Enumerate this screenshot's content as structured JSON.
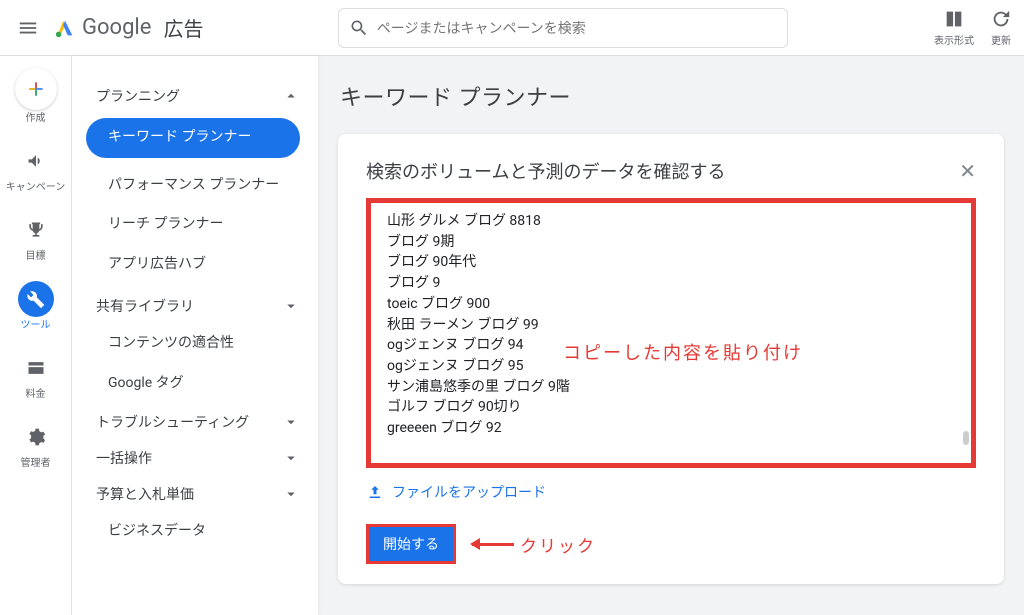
{
  "header": {
    "logo_brand": "Google",
    "logo_product": "広告",
    "search_placeholder": "ページまたはキャンペーンを検索",
    "actions": {
      "layout": "表示形式",
      "refresh": "更新"
    }
  },
  "rail": {
    "create": "作成",
    "campaign": "キャンペーン",
    "goal": "目標",
    "tools": "ツール",
    "billing": "料金",
    "admin": "管理者"
  },
  "side": {
    "planning": "プランニング",
    "keyword_planner": "キーワード プランナー",
    "performance_planner": "パフォーマンス プランナー",
    "reach_planner": "リーチ プランナー",
    "app_hub": "アプリ広告ハブ",
    "shared_lib": "共有ライブラリ",
    "content_suitability": "コンテンツの適合性",
    "google_tag": "Google タグ",
    "troubleshoot": "トラブルシューティング",
    "bulk": "一括操作",
    "budgets": "予算と入札単価",
    "biz_data": "ビジネスデータ"
  },
  "main": {
    "page_title": "キーワード プランナー",
    "card_title": "検索のボリュームと予測のデータを確認する",
    "keywords": [
      "山形 グルメ ブログ 8818",
      "ブログ 9期",
      "ブログ 90年代",
      "ブログ 9",
      "toeic ブログ 900",
      "秋田 ラーメン ブログ 99",
      "ogジェンヌ ブログ 94",
      "ogジェンヌ ブログ 95",
      "サン浦島悠季の里 ブログ 9階",
      "ゴルフ ブログ 90切り",
      "greeeen ブログ 92"
    ],
    "upload_label": "ファイルをアップロード",
    "start_label": "開始する",
    "annotation_paste": "コピーした内容を貼り付け",
    "annotation_click": "クリック"
  }
}
